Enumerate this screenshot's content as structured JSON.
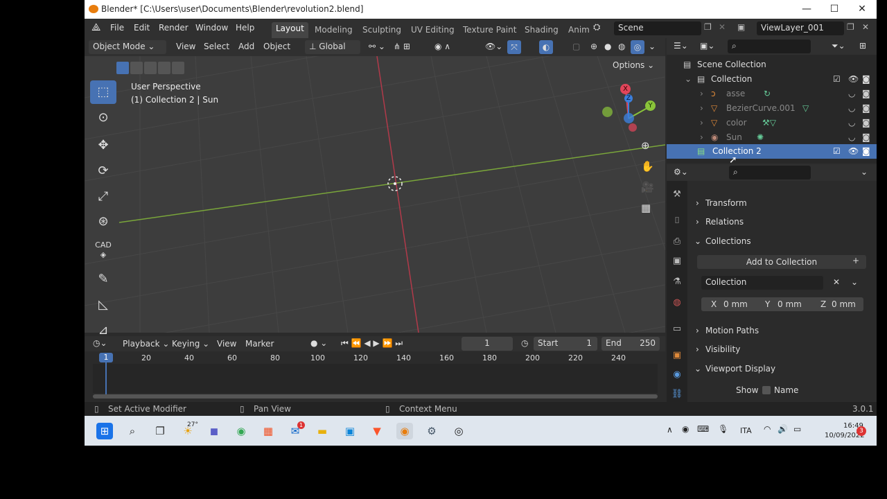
{
  "window": {
    "title": "Blender* [C:\\Users\\user\\Documents\\Blender\\revolution2.blend]",
    "minimize": "—",
    "maximize": "☐",
    "close": "✕"
  },
  "menu": {
    "items": [
      "File",
      "Edit",
      "Render",
      "Window",
      "Help"
    ],
    "workspaces": [
      "Layout",
      "Modeling",
      "Sculpting",
      "UV Editing",
      "Texture Paint",
      "Shading",
      "Anim"
    ],
    "scene": "Scene",
    "view_layer": "ViewLayer_001"
  },
  "viewport": {
    "mode": "Object Mode",
    "menus": [
      "View",
      "Select",
      "Add",
      "Object"
    ],
    "orientation": "Global",
    "options": "Options",
    "overlay_title": "User Perspective",
    "overlay_sub": "(1) Collection 2 | Sun",
    "gizmo": {
      "x": "X",
      "y": "Y",
      "z": "Z"
    },
    "cad_label": "CAD"
  },
  "outliner": {
    "root": "Scene Collection",
    "rows": [
      {
        "label": "Collection",
        "indent": 1
      },
      {
        "label": "asse",
        "indent": 2
      },
      {
        "label": "BezierCurve.001",
        "indent": 2
      },
      {
        "label": "color",
        "indent": 2
      },
      {
        "label": "Sun",
        "indent": 2
      },
      {
        "label": "Collection 2",
        "indent": 1
      }
    ]
  },
  "properties": {
    "panels": {
      "transform": "Transform",
      "relations": "Relations",
      "collections": "Collections",
      "motion_paths": "Motion Paths",
      "visibility": "Visibility",
      "viewport_display": "Viewport Display"
    },
    "add_to_collection": "Add to Collection",
    "collection_name": "Collection",
    "offset": {
      "x_label": "X",
      "x": "0 mm",
      "y_label": "Y",
      "y": "0 mm",
      "z_label": "Z",
      "z": "0 mm"
    },
    "show_label": "Show",
    "name_label": "Name"
  },
  "timeline": {
    "menus": [
      "Playback",
      "Keying",
      "View",
      "Marker"
    ],
    "current": "1",
    "start_label": "Start",
    "start": "1",
    "end_label": "End",
    "end": "250",
    "ticks": [
      "1",
      "20",
      "40",
      "60",
      "80",
      "100",
      "120",
      "140",
      "160",
      "180",
      "200",
      "220",
      "240"
    ]
  },
  "status": {
    "left": "Set Active Modifier",
    "mid": "Pan View",
    "right": "Context Menu",
    "version": "3.0.1"
  },
  "taskbar": {
    "weather": "27°",
    "lang": "ITA",
    "time": "16:49",
    "date": "10/09/2022",
    "notif": "3",
    "mail_badge": "1"
  },
  "colors": {
    "accent": "#4772b3",
    "x_axis": "#e1455a",
    "y_axis": "#8ac43a",
    "z_axis": "#3c7fdc"
  }
}
